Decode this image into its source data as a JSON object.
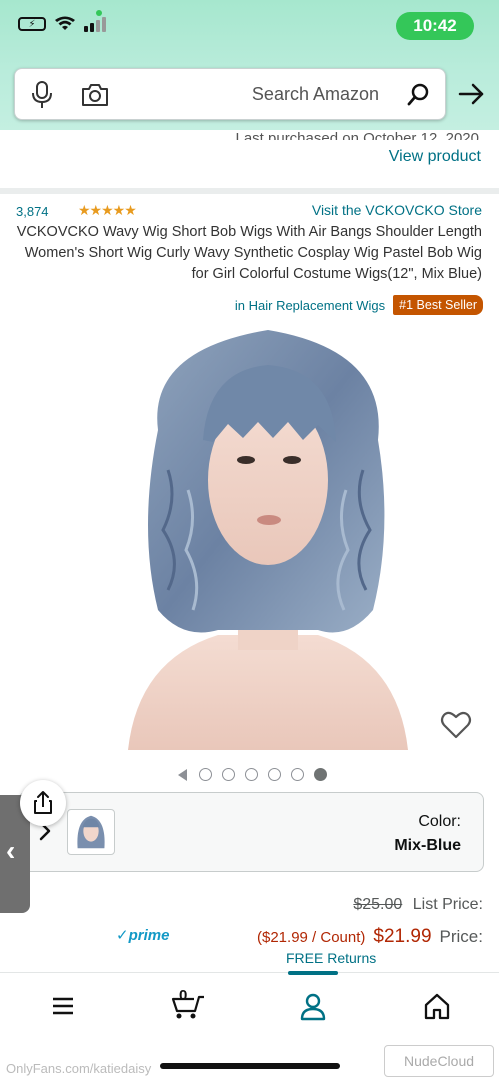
{
  "status_bar": {
    "time": "10:42"
  },
  "search": {
    "placeholder": "Search Amazon"
  },
  "previous_item": {
    "partial_text": "Last purchased on October 12, 2020",
    "view_product": "View product"
  },
  "product": {
    "store_link": "Visit the VCKOVCKO Store",
    "rating_stars": 4.5,
    "rating_count": "3,874",
    "title": "VCKOVCKO Wavy Wig Short Bob Wigs With Air Bangs Shoulder Length Women's Short Wig Curly Wavy Synthetic Cosplay Wig Pastel Bob Wig for Girl Colorful Costume Wigs(12\", Mix Blue)",
    "best_seller_badge": "#1 Best Seller",
    "best_seller_category": "in Hair Replacement Wigs",
    "image_count": 6,
    "active_image_index": 0,
    "color_label": "Color:",
    "color_value": "Mix-Blue",
    "list_price_label": "List Price:",
    "list_price": "$25.00",
    "price_label": "Price:",
    "price": "$21.99",
    "price_per_count": "($21.99 / Count)",
    "prime_label": "prime",
    "free_returns": "FREE Returns"
  },
  "bottom_nav": {
    "cart_count": "0",
    "active": "account"
  },
  "watermarks": {
    "left": "OnlyFans.com/katiedaisy",
    "right": "NudeCloud"
  },
  "colors": {
    "header_gradient": "#a6e7ce",
    "link": "#007185",
    "price": "#b12704",
    "badge": "#c45500",
    "star": "#e89b1f"
  }
}
